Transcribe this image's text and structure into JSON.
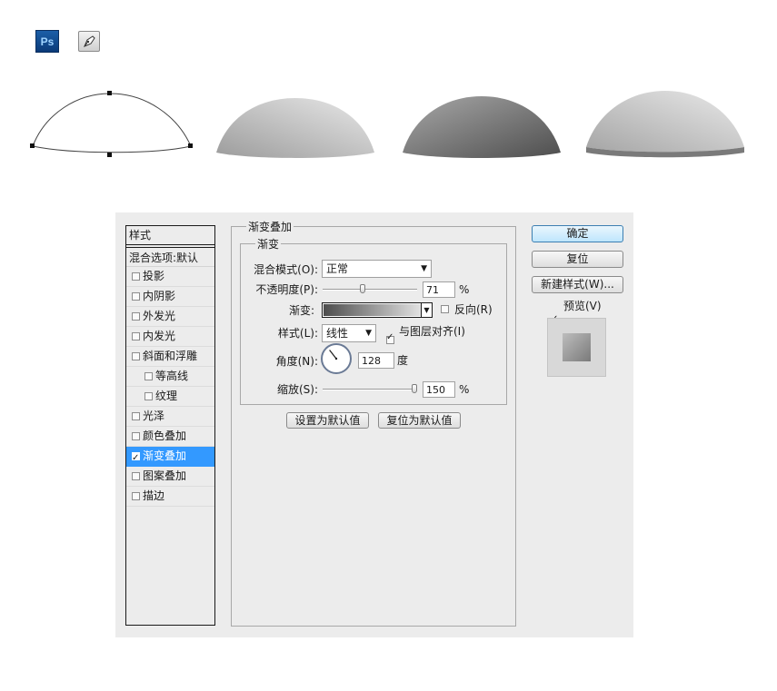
{
  "top_icons": {
    "photoshop_label": "Ps",
    "pen_tool": "pen-tool-icon"
  },
  "dialog": {
    "styles_header": "样式",
    "blend_options": "混合选项:默认",
    "style_items": [
      {
        "label": "投影",
        "checked": false,
        "indent": false,
        "selected": false
      },
      {
        "label": "内阴影",
        "checked": false,
        "indent": false,
        "selected": false
      },
      {
        "label": "外发光",
        "checked": false,
        "indent": false,
        "selected": false
      },
      {
        "label": "内发光",
        "checked": false,
        "indent": false,
        "selected": false
      },
      {
        "label": "斜面和浮雕",
        "checked": false,
        "indent": false,
        "selected": false
      },
      {
        "label": "等高线",
        "checked": false,
        "indent": true,
        "selected": false
      },
      {
        "label": "纹理",
        "checked": false,
        "indent": true,
        "selected": false
      },
      {
        "label": "光泽",
        "checked": false,
        "indent": false,
        "selected": false
      },
      {
        "label": "颜色叠加",
        "checked": false,
        "indent": false,
        "selected": false
      },
      {
        "label": "渐变叠加",
        "checked": true,
        "indent": false,
        "selected": true
      },
      {
        "label": "图案叠加",
        "checked": false,
        "indent": false,
        "selected": false
      },
      {
        "label": "描边",
        "checked": false,
        "indent": false,
        "selected": false
      }
    ],
    "panel_title": "渐变叠加",
    "group_title": "渐变",
    "blend_mode_label": "混合模式(O):",
    "blend_mode_value": "正常",
    "opacity_label": "不透明度(P):",
    "opacity_value": "71",
    "opacity_unit": "%",
    "opacity_fraction": 0.71,
    "gradient_label": "渐变:",
    "reverse_label": "反向(R)",
    "reverse_checked": false,
    "style_label": "样式(L):",
    "style_value": "线性",
    "align_label": "与图层对齐(I)",
    "align_checked": true,
    "angle_label": "角度(N):",
    "angle_value": "128",
    "angle_deg": 128,
    "angle_unit": "度",
    "scale_label": "缩放(S):",
    "scale_value": "150",
    "scale_unit": "%",
    "scale_fraction": 1.0,
    "set_default_button": "设置为默认值",
    "reset_default_button": "复位为默认值",
    "ok_button": "确定",
    "reset_button": "复位",
    "new_style_button": "新建样式(W)...",
    "preview_label": "预览(V)",
    "preview_checked": true
  },
  "colors": {
    "dialog_bg": "#ececec",
    "selection_blue": "#3399ff",
    "gradient_dark": "#4d4d4d",
    "gradient_light": "#e2e2e2"
  }
}
